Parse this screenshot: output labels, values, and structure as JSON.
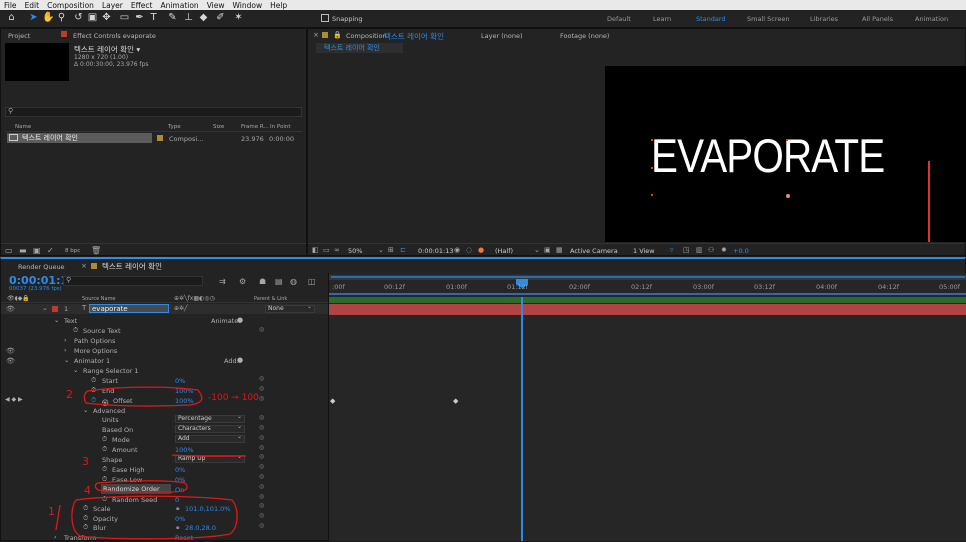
{
  "menu": [
    "File",
    "Edit",
    "Composition",
    "Layer",
    "Effect",
    "Animation",
    "View",
    "Window",
    "Help"
  ],
  "toolbar": {
    "snapping": "Snapping",
    "workspaces": [
      "Default",
      "Learn",
      "Standard",
      "Small Screen",
      "Libraries",
      "All Panels",
      "Animation"
    ],
    "active_workspace": "Standard"
  },
  "project": {
    "tab": "Project",
    "effect_tab": "Effect Controls evaporate",
    "comp_name": "텍스트 레이어 확인 ▾",
    "comp_size": "1280 x 720 (1.00)",
    "comp_duration": "Δ 0:00:30:00, 23.976 fps",
    "col_name": "Name",
    "col_type": "Type",
    "col_size": "Size",
    "col_frame": "Frame R...",
    "col_in": "In Point",
    "item_name": "텍스트 레이어 확인",
    "item_type": "Composi...",
    "item_fps": "23.976",
    "item_in": "0:00:00",
    "bpc": "8 bpc"
  },
  "viewer": {
    "tab_prefix": "Composition",
    "tab_name": "텍스트 레이어 확인",
    "layer_tab": "Layer  (none)",
    "footage_tab": "Footage  (none)",
    "breadcrumb": "텍스트 레이어 확인",
    "canvas_text": "EVAPORATE",
    "zoom": "50%",
    "timecode": "0:00:01:13",
    "resolution": "(Half)",
    "camera": "Active Camera",
    "views": "1 View",
    "exposure": "+0.0"
  },
  "timeline": {
    "render_queue": "Render Queue",
    "tab": "텍스트 레이어 확인",
    "timecode": "0:00:01:13",
    "fps_sub": "00037 (23.976 fps)",
    "col_source": "Source Name",
    "col_parent": "Parent & Link",
    "layer_num": "1",
    "layer_name": "evaporate",
    "parent": "None",
    "ruler": [
      ":00f",
      "00:12f",
      "01:00f",
      "01:12f",
      "02:00f",
      "02:12f",
      "03:00f",
      "03:12f",
      "04:00f",
      "04:12f",
      "05:00f"
    ],
    "props": {
      "text": "Text",
      "animate": "Animate:",
      "source_text": "Source Text",
      "path_options": "Path Options",
      "more_options": "More Options",
      "animator": "Animator 1",
      "add": "Add:",
      "range_selector": "Range Selector 1",
      "start": "Start",
      "start_val": "0%",
      "end": "End",
      "end_val": "100%",
      "offset": "Offset",
      "offset_val": "100%",
      "advanced": "Advanced",
      "units": "Units",
      "units_val": "Percentage",
      "based_on": "Based On",
      "based_on_val": "Characters",
      "mode": "Mode",
      "mode_val": "Add",
      "amount": "Amount",
      "amount_val": "100%",
      "shape": "Shape",
      "shape_val": "Ramp Up",
      "ease_high": "Ease High",
      "ease_high_val": "0%",
      "ease_low": "Ease Low",
      "ease_low_val": "0%",
      "randomize": "Randomize Order",
      "randomize_val": "On",
      "random_seed": "Random Seed",
      "random_seed_val": "0",
      "scale": "Scale",
      "scale_val": "101.0,101.0%",
      "opacity": "Opacity",
      "opacity_val": "0%",
      "blur": "Blur",
      "blur_val": "28.0,28.0",
      "transform": "Transform",
      "reset": "Reset"
    }
  },
  "annotations": {
    "n1": "1",
    "n2": "2",
    "n3": "3",
    "n4": "4",
    "offset_note": "-100 → 100"
  }
}
